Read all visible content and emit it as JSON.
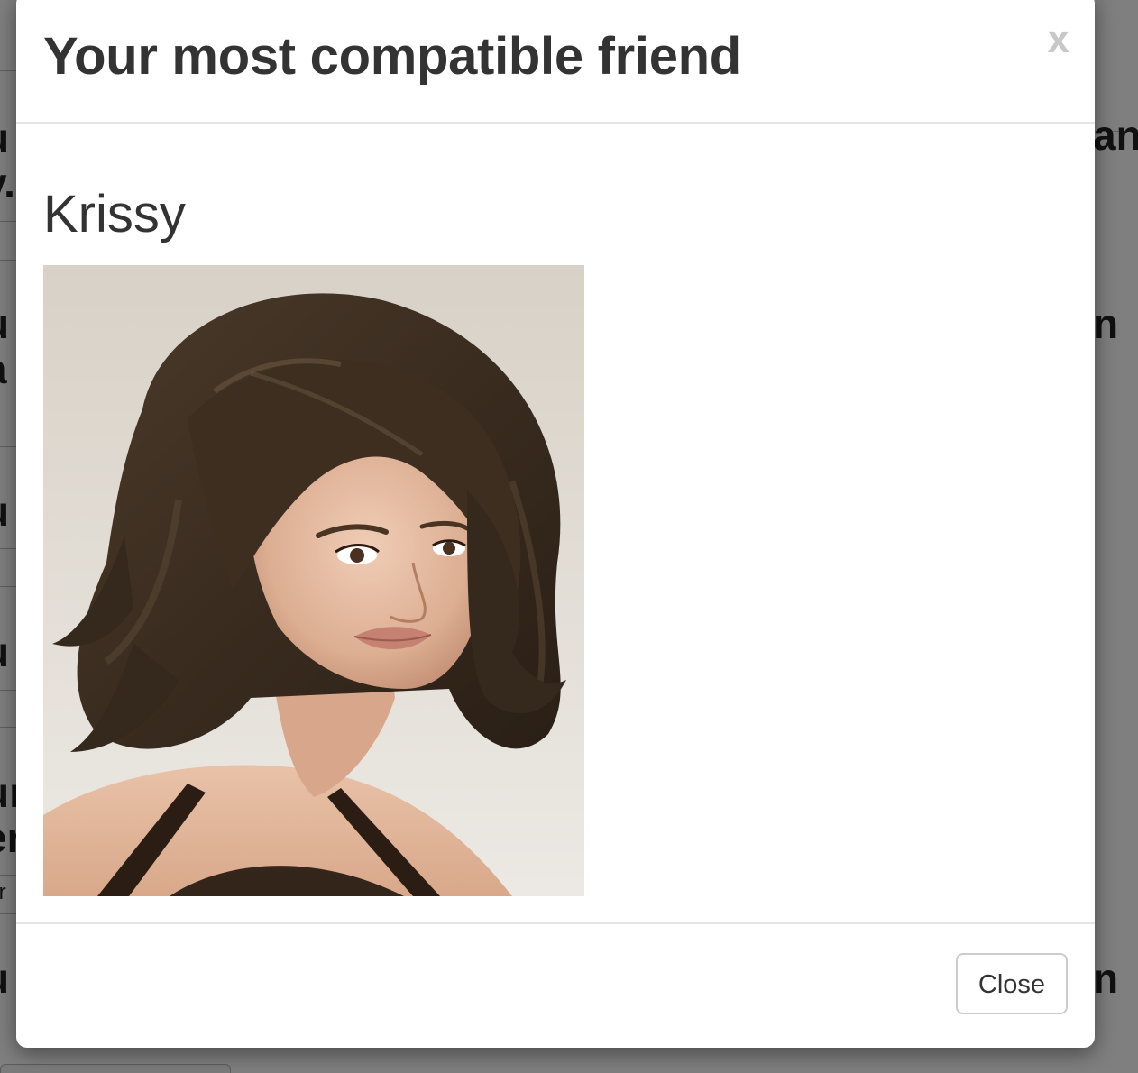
{
  "modal": {
    "title": "Your most compatible friend",
    "close_icon_label": "x",
    "friend_name": "Krissy",
    "photo_alt": "Krissy",
    "close_button_label": "Close"
  },
  "icons": {
    "close": "close-icon"
  },
  "colors": {
    "backdrop": "rgba(0,0,0,0.5)",
    "title_text": "#333333",
    "close_icon": "#c8c8c8",
    "divider": "#e5e5e5",
    "button_border": "#cccccc"
  }
}
